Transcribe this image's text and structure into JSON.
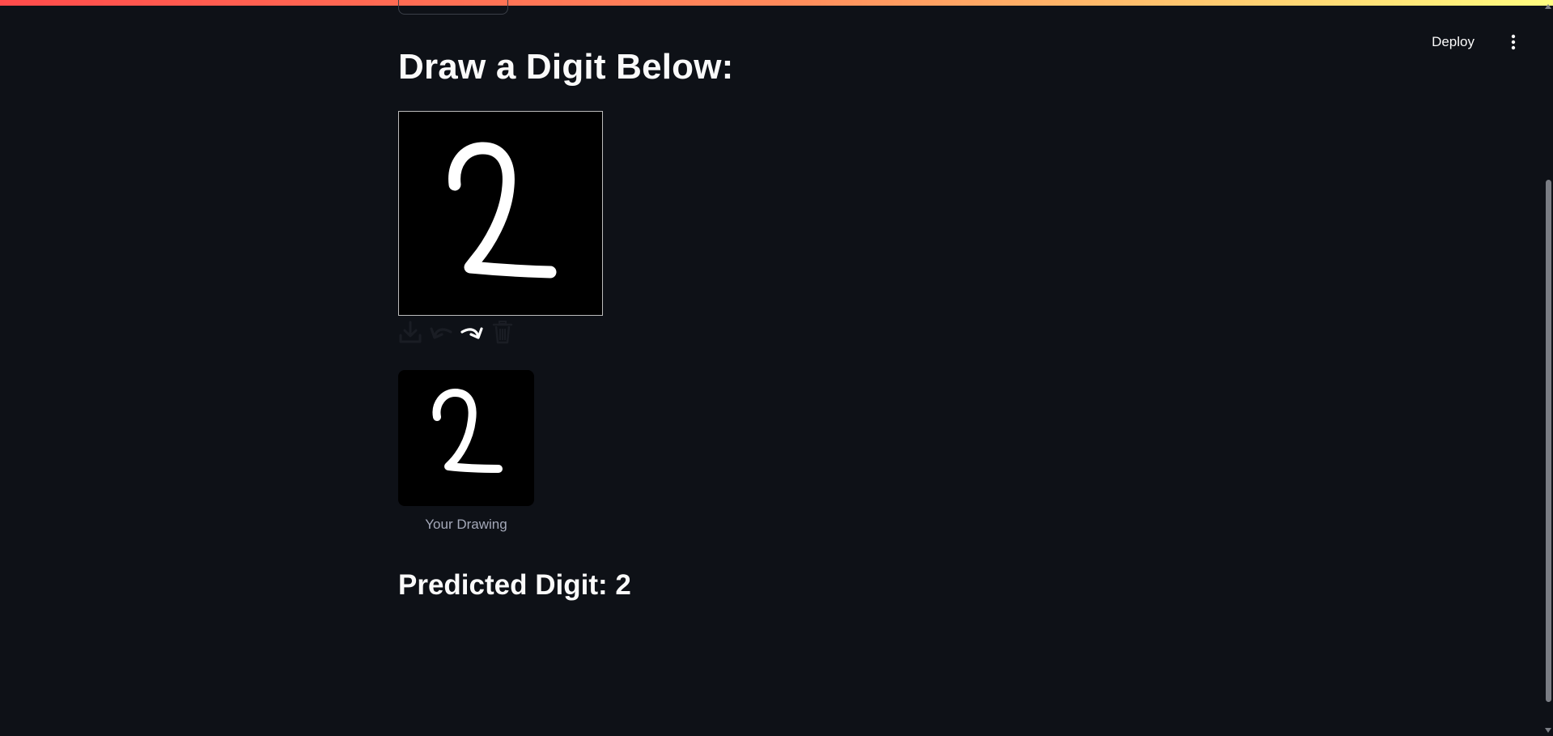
{
  "header": {
    "deploy_label": "Deploy",
    "menu_icon": "kebab-menu-icon"
  },
  "main": {
    "heading": "Draw a Digit Below:",
    "canvas": {
      "background": "#000000",
      "stroke_color": "#ffffff",
      "drawn_digit": "2"
    },
    "toolbar": [
      {
        "name": "download-icon",
        "label": "Download"
      },
      {
        "name": "undo-icon",
        "label": "Undo"
      },
      {
        "name": "redo-icon",
        "label": "Redo"
      },
      {
        "name": "trash-icon",
        "label": "Clear"
      }
    ],
    "image_caption": "Your Drawing",
    "prediction": "Predicted Digit: 2"
  },
  "colors": {
    "background": "#0e1117",
    "text": "#fafafa",
    "caption": "#a3a8b8",
    "accent_gradient": [
      "#ff4b4b",
      "#fffd80"
    ]
  }
}
